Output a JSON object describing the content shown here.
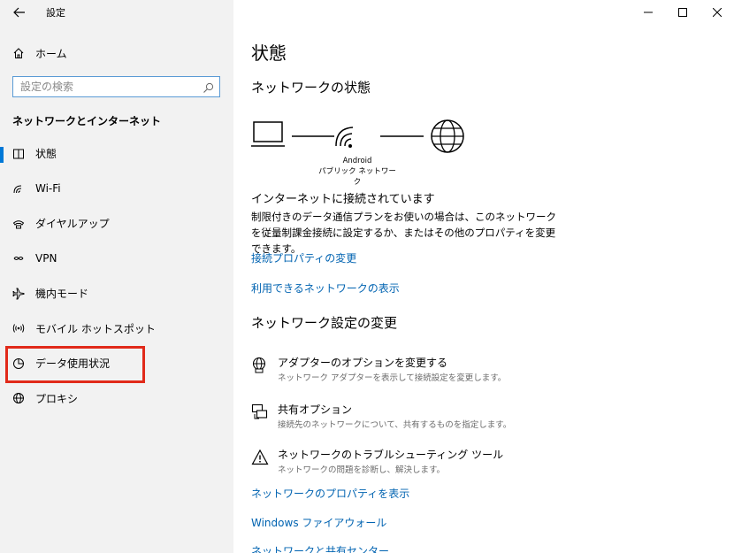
{
  "window": {
    "title": "設定"
  },
  "sidebar": {
    "home_label": "ホーム",
    "search_placeholder": "設定の検索",
    "section_title": "ネットワークとインターネット",
    "items": [
      {
        "label": "状態",
        "icon": "status-icon",
        "active": true
      },
      {
        "label": "Wi-Fi",
        "icon": "wifi-icon",
        "active": false
      },
      {
        "label": "ダイヤルアップ",
        "icon": "dialup-icon",
        "active": false
      },
      {
        "label": "VPN",
        "icon": "vpn-icon",
        "active": false
      },
      {
        "label": "機内モード",
        "icon": "airplane-icon",
        "active": false
      },
      {
        "label": "モバイル ホットスポット",
        "icon": "hotspot-icon",
        "active": false
      },
      {
        "label": "データ使用状況",
        "icon": "data-usage-icon",
        "active": false
      },
      {
        "label": "プロキシ",
        "icon": "globe-icon",
        "active": false
      }
    ]
  },
  "main": {
    "title": "状態",
    "network_status_heading": "ネットワークの状態",
    "network_name": "Android",
    "network_type": "パブリック ネットワーク",
    "connection_title": "インターネットに接続されています",
    "connection_description": "制限付きのデータ通信プランをお使いの場合は、このネットワークを従量制課金接続に設定するか、またはその他のプロパティを変更できます。",
    "links": {
      "connection_properties": "接続プロパティの変更",
      "available_networks": "利用できるネットワークの表示"
    },
    "change_settings_heading": "ネットワーク設定の変更",
    "options": [
      {
        "title": "アダプターのオプションを変更する",
        "description": "ネットワーク アダプターを表示して接続設定を変更します。",
        "icon": "adapter-icon"
      },
      {
        "title": "共有オプション",
        "description": "接続先のネットワークについて、共有するものを指定します。",
        "icon": "sharing-icon"
      },
      {
        "title": "ネットワークのトラブルシューティング ツール",
        "description": "ネットワークの問題を診断し、解決します。",
        "icon": "warning-icon"
      }
    ],
    "bottom_links": {
      "network_properties": "ネットワークのプロパティを表示",
      "firewall": "Windows ファイアウォール",
      "sharing_center": "ネットワークと共有センター"
    }
  },
  "colors": {
    "accent": "#0078d7",
    "link": "#0063b1",
    "highlight": "#e12a1a",
    "sidebar_bg": "#f2f2f2"
  }
}
